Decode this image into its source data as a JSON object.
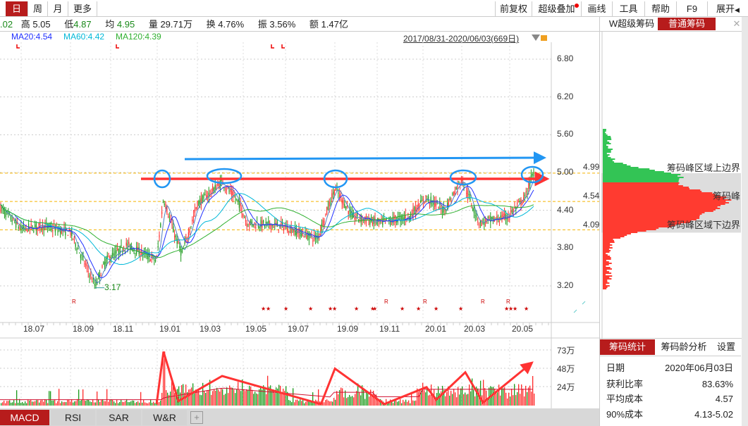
{
  "topbar": {
    "tabs": [
      "日",
      "周",
      "月",
      "更多"
    ],
    "active_tab": "日",
    "right_buttons": [
      "前复权",
      "超级叠加",
      "画线",
      "工具",
      "帮助",
      "F9",
      "展开"
    ]
  },
  "quote": {
    "open_partial": ".02",
    "high_label": "高",
    "high": "5.05",
    "low_label": "低",
    "low": "4.87",
    "avg_label": "均",
    "avg": "4.95",
    "vol_label": "量",
    "vol": "29.71万",
    "turn_label": "换",
    "turn": "4.76%",
    "amp_label": "振",
    "amp": "3.56%",
    "amt_label": "额",
    "amt": "1.47亿"
  },
  "ma": {
    "ma20": "MA20:4.54",
    "ma60": "MA60:4.42",
    "ma120": "MA120:4.39"
  },
  "range_label": "2017/08/31-2020/06/03(669日)",
  "price_axis": [
    "6.80",
    "6.20",
    "5.60",
    "5.00",
    "4.40",
    "3.80",
    "3.20"
  ],
  "date_axis": [
    "18.07",
    "18.09",
    "18.11",
    "19.01",
    "19.03",
    "19.05",
    "19.07",
    "19.09",
    "19.11",
    "20.01",
    "20.03",
    "20.05"
  ],
  "low_marker": "3.17",
  "volume_axis": [
    "73万",
    "48万",
    "24万"
  ],
  "bottom_tabs": [
    "MACD",
    "RSI",
    "SAR",
    "W&R"
  ],
  "right_panel": {
    "tabs": [
      "W超级筹码",
      "普通筹码"
    ],
    "active_tab": "普通筹码",
    "levels": {
      "upper": "4.99",
      "peak": "4.54",
      "lower": "4.09"
    },
    "labels": {
      "upper": "筹码峰区域上边界",
      "peak": "筹码峰",
      "lower": "筹码峰区域下边界"
    },
    "stat_tabs": [
      "筹码统计",
      "筹码龄分析",
      "设置"
    ],
    "stats": [
      {
        "k": "日期",
        "v": "2020年06月03日"
      },
      {
        "k": "获利比率",
        "v": "83.63%"
      },
      {
        "k": "平均成本",
        "v": "4.57"
      },
      {
        "k": "90%成本",
        "v": "4.13-5.02"
      }
    ]
  },
  "colors": {
    "up": "#ff2a2a",
    "down": "#1a9a1a",
    "accent": "#b71c1c",
    "ma20": "#2030ff",
    "ma60": "#00b8d8",
    "ma120": "#30b030",
    "annot_blue": "#2196f3"
  },
  "chart_data": {
    "type": "candlestick",
    "x_unit": "months since 2018.07",
    "price_path": [
      [
        -0.95,
        4.45
      ],
      [
        0,
        4.1
      ],
      [
        0.95,
        4.15
      ],
      [
        2.22,
        4.05
      ],
      [
        3.33,
        3.2
      ],
      [
        3.81,
        3.6
      ],
      [
        4.76,
        3.85
      ],
      [
        6.1,
        3.6
      ],
      [
        6.41,
        4.6
      ],
      [
        6.83,
        4.1
      ],
      [
        7.24,
        3.7
      ],
      [
        7.94,
        4.5
      ],
      [
        9.05,
        4.85
      ],
      [
        9.84,
        4.5
      ],
      [
        10.16,
        4.2
      ],
      [
        11.75,
        4.15
      ],
      [
        13.33,
        3.95
      ],
      [
        14.13,
        4.75
      ],
      [
        14.92,
        4.3
      ],
      [
        16.19,
        4.2
      ],
      [
        17.46,
        4.3
      ],
      [
        18.25,
        4.6
      ],
      [
        19.05,
        4.4
      ],
      [
        19.84,
        4.9
      ],
      [
        20.63,
        4.2
      ],
      [
        21.9,
        4.3
      ],
      [
        22.7,
        4.6
      ],
      [
        23.0,
        4.95
      ]
    ],
    "ylim": [
      2.9,
      7.1
    ],
    "volume_peaks_wan": [
      [
        6.1,
        2
      ],
      [
        6.41,
        73
      ],
      [
        7.08,
        6
      ],
      [
        9.05,
        40
      ],
      [
        13.5,
        2
      ],
      [
        14.13,
        50
      ],
      [
        16.35,
        2
      ],
      [
        18.25,
        25
      ],
      [
        18.7,
        8
      ],
      [
        20.0,
        45
      ],
      [
        20.8,
        4
      ],
      [
        23.0,
        58
      ]
    ]
  }
}
